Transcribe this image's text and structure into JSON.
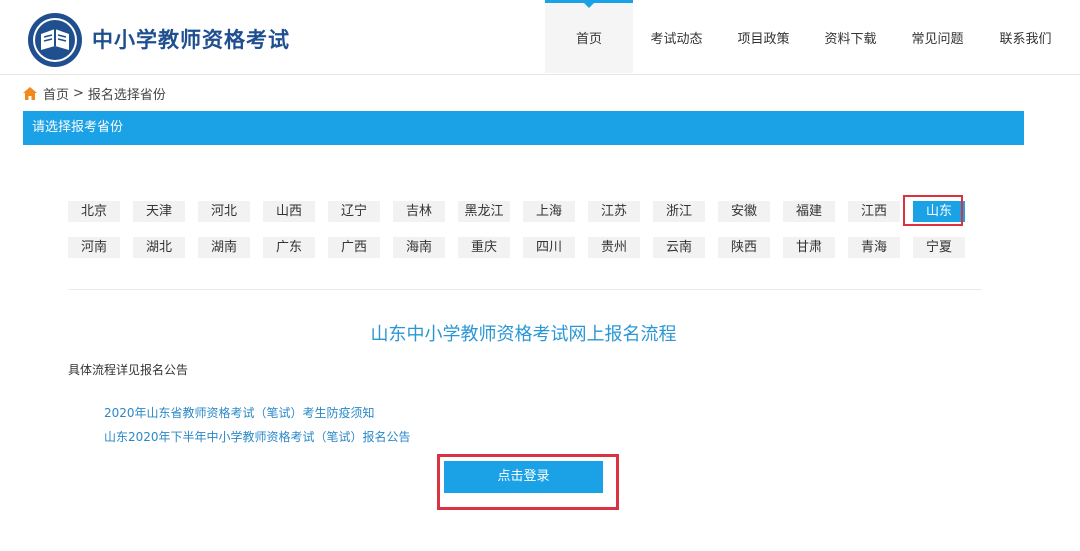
{
  "header": {
    "site_title": "中小学教师资格考试",
    "nav": [
      {
        "label": "首页",
        "active": true
      },
      {
        "label": "考试动态"
      },
      {
        "label": "项目政策"
      },
      {
        "label": "资料下载"
      },
      {
        "label": "常见问题"
      },
      {
        "label": "联系我们"
      }
    ]
  },
  "breadcrumb": {
    "home": "首页",
    "separator": ">",
    "current": "报名选择省份"
  },
  "section": {
    "title": "请选择报考省份"
  },
  "provinces": {
    "row1": [
      "北京",
      "天津",
      "河北",
      "山西",
      "辽宁",
      "吉林",
      "黑龙江",
      "上海",
      "江苏",
      "浙江",
      "安徽",
      "福建",
      "江西",
      "山东"
    ],
    "row2": [
      "河南",
      "湖北",
      "湖南",
      "广东",
      "广西",
      "海南",
      "重庆",
      "四川",
      "贵州",
      "云南",
      "陕西",
      "甘肃",
      "青海",
      "宁夏"
    ],
    "selected": "山东"
  },
  "process": {
    "title": "山东中小学教师资格考试网上报名流程",
    "note": "具体流程详见报名公告",
    "links": [
      "2020年山东省教师资格考试（笔试）考生防疫须知",
      "山东2020年下半年中小学教师资格考试（笔试）报名公告"
    ],
    "login_label": "点击登录"
  },
  "colors": {
    "accent": "#1aa1e6",
    "title_blue": "#1f4f8f",
    "highlight_red": "#d9333f"
  }
}
